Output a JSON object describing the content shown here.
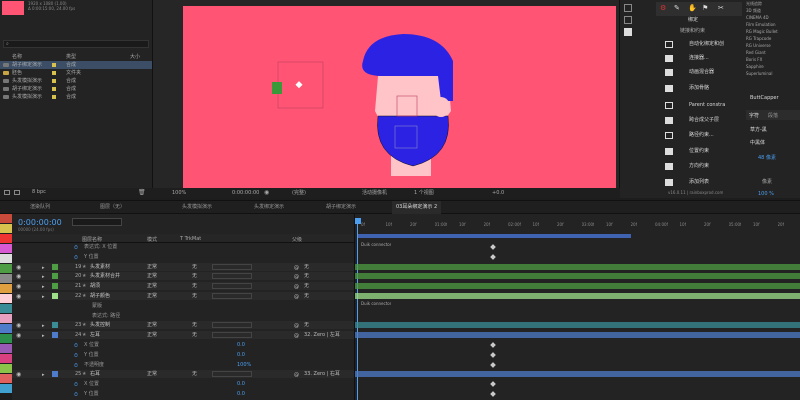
{
  "project": {
    "header_meta": "1920 x 1080 (1.00)\nΔ 0:00:15:00, 24.00 fps",
    "columns": {
      "name": "名称",
      "type": "类型",
      "size": "大小"
    },
    "items": [
      {
        "label": "胡子绑定演示",
        "type": "合成",
        "color": "#d6c24d"
      },
      {
        "label": "胚色",
        "type": "文件夹",
        "color": "#d6c24d"
      },
      {
        "label": "头发模拟演示",
        "type": "合成",
        "color": "#d6c24d"
      },
      {
        "label": "胡子绑定演示",
        "type": "合成",
        "color": "#d6c24d"
      },
      {
        "label": "头发模拟演示",
        "type": "合成",
        "color": "#d6c24d"
      }
    ],
    "footer_bpc": "8 bpc"
  },
  "viewer": {
    "zoom": "100%",
    "timecode": "0:00:00:00",
    "resolution": "(完整)",
    "camera": "活动摄像机",
    "views": "1 个视图",
    "offset": "+0.0"
  },
  "right_panel": {
    "top_label": "绑定",
    "sub_label": "链接和约束",
    "menu": [
      "自动化绑定和创",
      "连接器...",
      "动画混合器",
      "添加骨骼",
      "Parent constra",
      "跨合成父子层",
      "路径约束...",
      "位置约束",
      "方向约束",
      "添加列表"
    ],
    "version": "v16.0.11 | rainboxprod.com",
    "effects": [
      "光线追踪",
      "3D 频道",
      "CINEMA 4D",
      "Film Emulation",
      "RG Magic Bullet",
      "RG Trapcode",
      "RG Universe",
      "Red Giant",
      "Boris FX",
      "Sapphire",
      "Superluminal"
    ],
    "butt_label": "ButtCapper",
    "char_tab": "字符",
    "para_tab": "段落",
    "font": "草方-黑",
    "font_style": "中黑体",
    "size_val": "48 像素",
    "tracking": "像素",
    "scale": "100 %",
    "color_accent": "#2a7cd5"
  },
  "timeline": {
    "tabs": [
      "渲染队列",
      "图层（无）",
      "头发模拟演示",
      "头发绑定演示",
      "胡子绑定演示",
      "03耳朵绑定演示 2"
    ],
    "timecode": "0:00:00:00",
    "frame_info": "00000 (24.00 fps)",
    "col_headers": {
      "name": "图层名称",
      "mode": "模式",
      "trkmat": "T TrkMat",
      "parent": "父级"
    },
    "ruler_ticks": [
      "0f",
      "10f",
      "20f",
      "01:00f",
      "10f",
      "20f",
      "02:00f",
      "10f",
      "20f",
      "03:00f",
      "10f",
      "20f",
      "04:00f",
      "10f",
      "20f",
      "05:00f",
      "10f",
      "20f"
    ],
    "layers": [
      {
        "kind": "prop",
        "label": "表达式: X 位置",
        "indent": 0
      },
      {
        "kind": "prop",
        "label": "Y 位置",
        "indent": 0
      },
      {
        "kind": "layer",
        "num": "19",
        "name": "头发素材",
        "mode": "正常",
        "trk": "无",
        "parent": "无",
        "color": "#4e9c43"
      },
      {
        "kind": "layer",
        "num": "20",
        "name": "头发素材合并",
        "mode": "正常",
        "trk": "无",
        "parent": "无",
        "color": "#4e9c43"
      },
      {
        "kind": "layer",
        "num": "21",
        "name": "胡须",
        "mode": "正常",
        "trk": "无",
        "parent": "无",
        "color": "#4e9c43"
      },
      {
        "kind": "layer",
        "num": "22",
        "name": "胡子颜色",
        "mode": "正常",
        "trk": "无",
        "parent": "无",
        "color": "#9ee08a"
      },
      {
        "kind": "sub",
        "label": "蒙版"
      },
      {
        "kind": "sub",
        "label": "表达式: 路径"
      },
      {
        "kind": "layer",
        "num": "23",
        "name": "头发控制",
        "mode": "正常",
        "trk": "无",
        "parent": "无",
        "color": "#3a8d97"
      },
      {
        "kind": "layer",
        "num": "24",
        "name": "左耳",
        "mode": "正常",
        "trk": "无",
        "parent": "32. Zero | 左耳",
        "color": "#4f7cca"
      },
      {
        "kind": "prop",
        "label": "X 位置",
        "value": "0.0"
      },
      {
        "kind": "prop",
        "label": "Y 位置",
        "value": "0.0"
      },
      {
        "kind": "prop",
        "label": "不透明度",
        "value": "100%"
      },
      {
        "kind": "layer",
        "num": "25",
        "name": "右耳",
        "mode": "正常",
        "trk": "无",
        "parent": "33. Zero | 右耳",
        "color": "#4f7cca"
      },
      {
        "kind": "prop",
        "label": "X 位置",
        "value": "0.0"
      },
      {
        "kind": "prop",
        "label": "Y 位置",
        "value": "0.0"
      }
    ],
    "comment_label": "Duik connector"
  },
  "colors": {
    "canvas": "#ff5473",
    "hair": "#2c22e3",
    "skin": "#ffc4c7",
    "accent": "#2a7cd5"
  }
}
